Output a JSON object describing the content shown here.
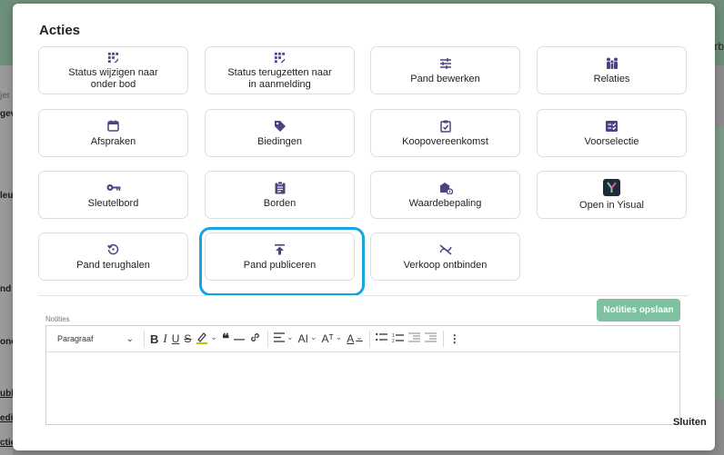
{
  "background": {
    "fragments": [
      "jer",
      "gev",
      "leu",
      "nd",
      "onc",
      "ubli",
      "edi",
      "ctie"
    ],
    "right_fragment": "rb"
  },
  "modal": {
    "title": "Acties",
    "actions": [
      {
        "label": "Status wijzigen naar onder bod",
        "icon": "status-grid-icon"
      },
      {
        "label": "Status terugzetten naar in aanmelding",
        "icon": "status-grid-icon"
      },
      {
        "label": "Pand bewerken",
        "icon": "sliders-icon"
      },
      {
        "label": "Relaties",
        "icon": "people-icon"
      },
      {
        "label": "Afspraken",
        "icon": "calendar-icon"
      },
      {
        "label": "Biedingen",
        "icon": "tag-icon"
      },
      {
        "label": "Koopovereenkomst",
        "icon": "clipboard-check-icon"
      },
      {
        "label": "Voorselectie",
        "icon": "checklist-icon"
      },
      {
        "label": "Sleutelbord",
        "icon": "key-icon"
      },
      {
        "label": "Borden",
        "icon": "clipboard-list-icon"
      },
      {
        "label": "Waardebepaling",
        "icon": "house-value-icon"
      },
      {
        "label": "Open in Yisual",
        "icon": "yisual-logo-icon"
      },
      {
        "label": "Pand terughalen",
        "icon": "restore-icon"
      },
      {
        "label": "Pand publiceren",
        "icon": "upload-icon"
      },
      {
        "label": "Verkoop ontbinden",
        "icon": "unlink-icon"
      }
    ],
    "highlighted_action": "Pand publiceren",
    "save_notes_label": "Notities opslaan",
    "notes_label": "Notities",
    "editor": {
      "paragraph_select": "Paragraaf",
      "bold": "B",
      "italic": "I",
      "underline": "U",
      "strike": "S",
      "quote": "❝",
      "hr": "—",
      "font_size": "AI",
      "text_style": "Aᵀ",
      "font_color": "A"
    },
    "close_label": "Sluiten"
  },
  "colors": {
    "icon": "#4a4580",
    "highlight": "#1aa3dd",
    "save_button": "#7dc1a0"
  }
}
